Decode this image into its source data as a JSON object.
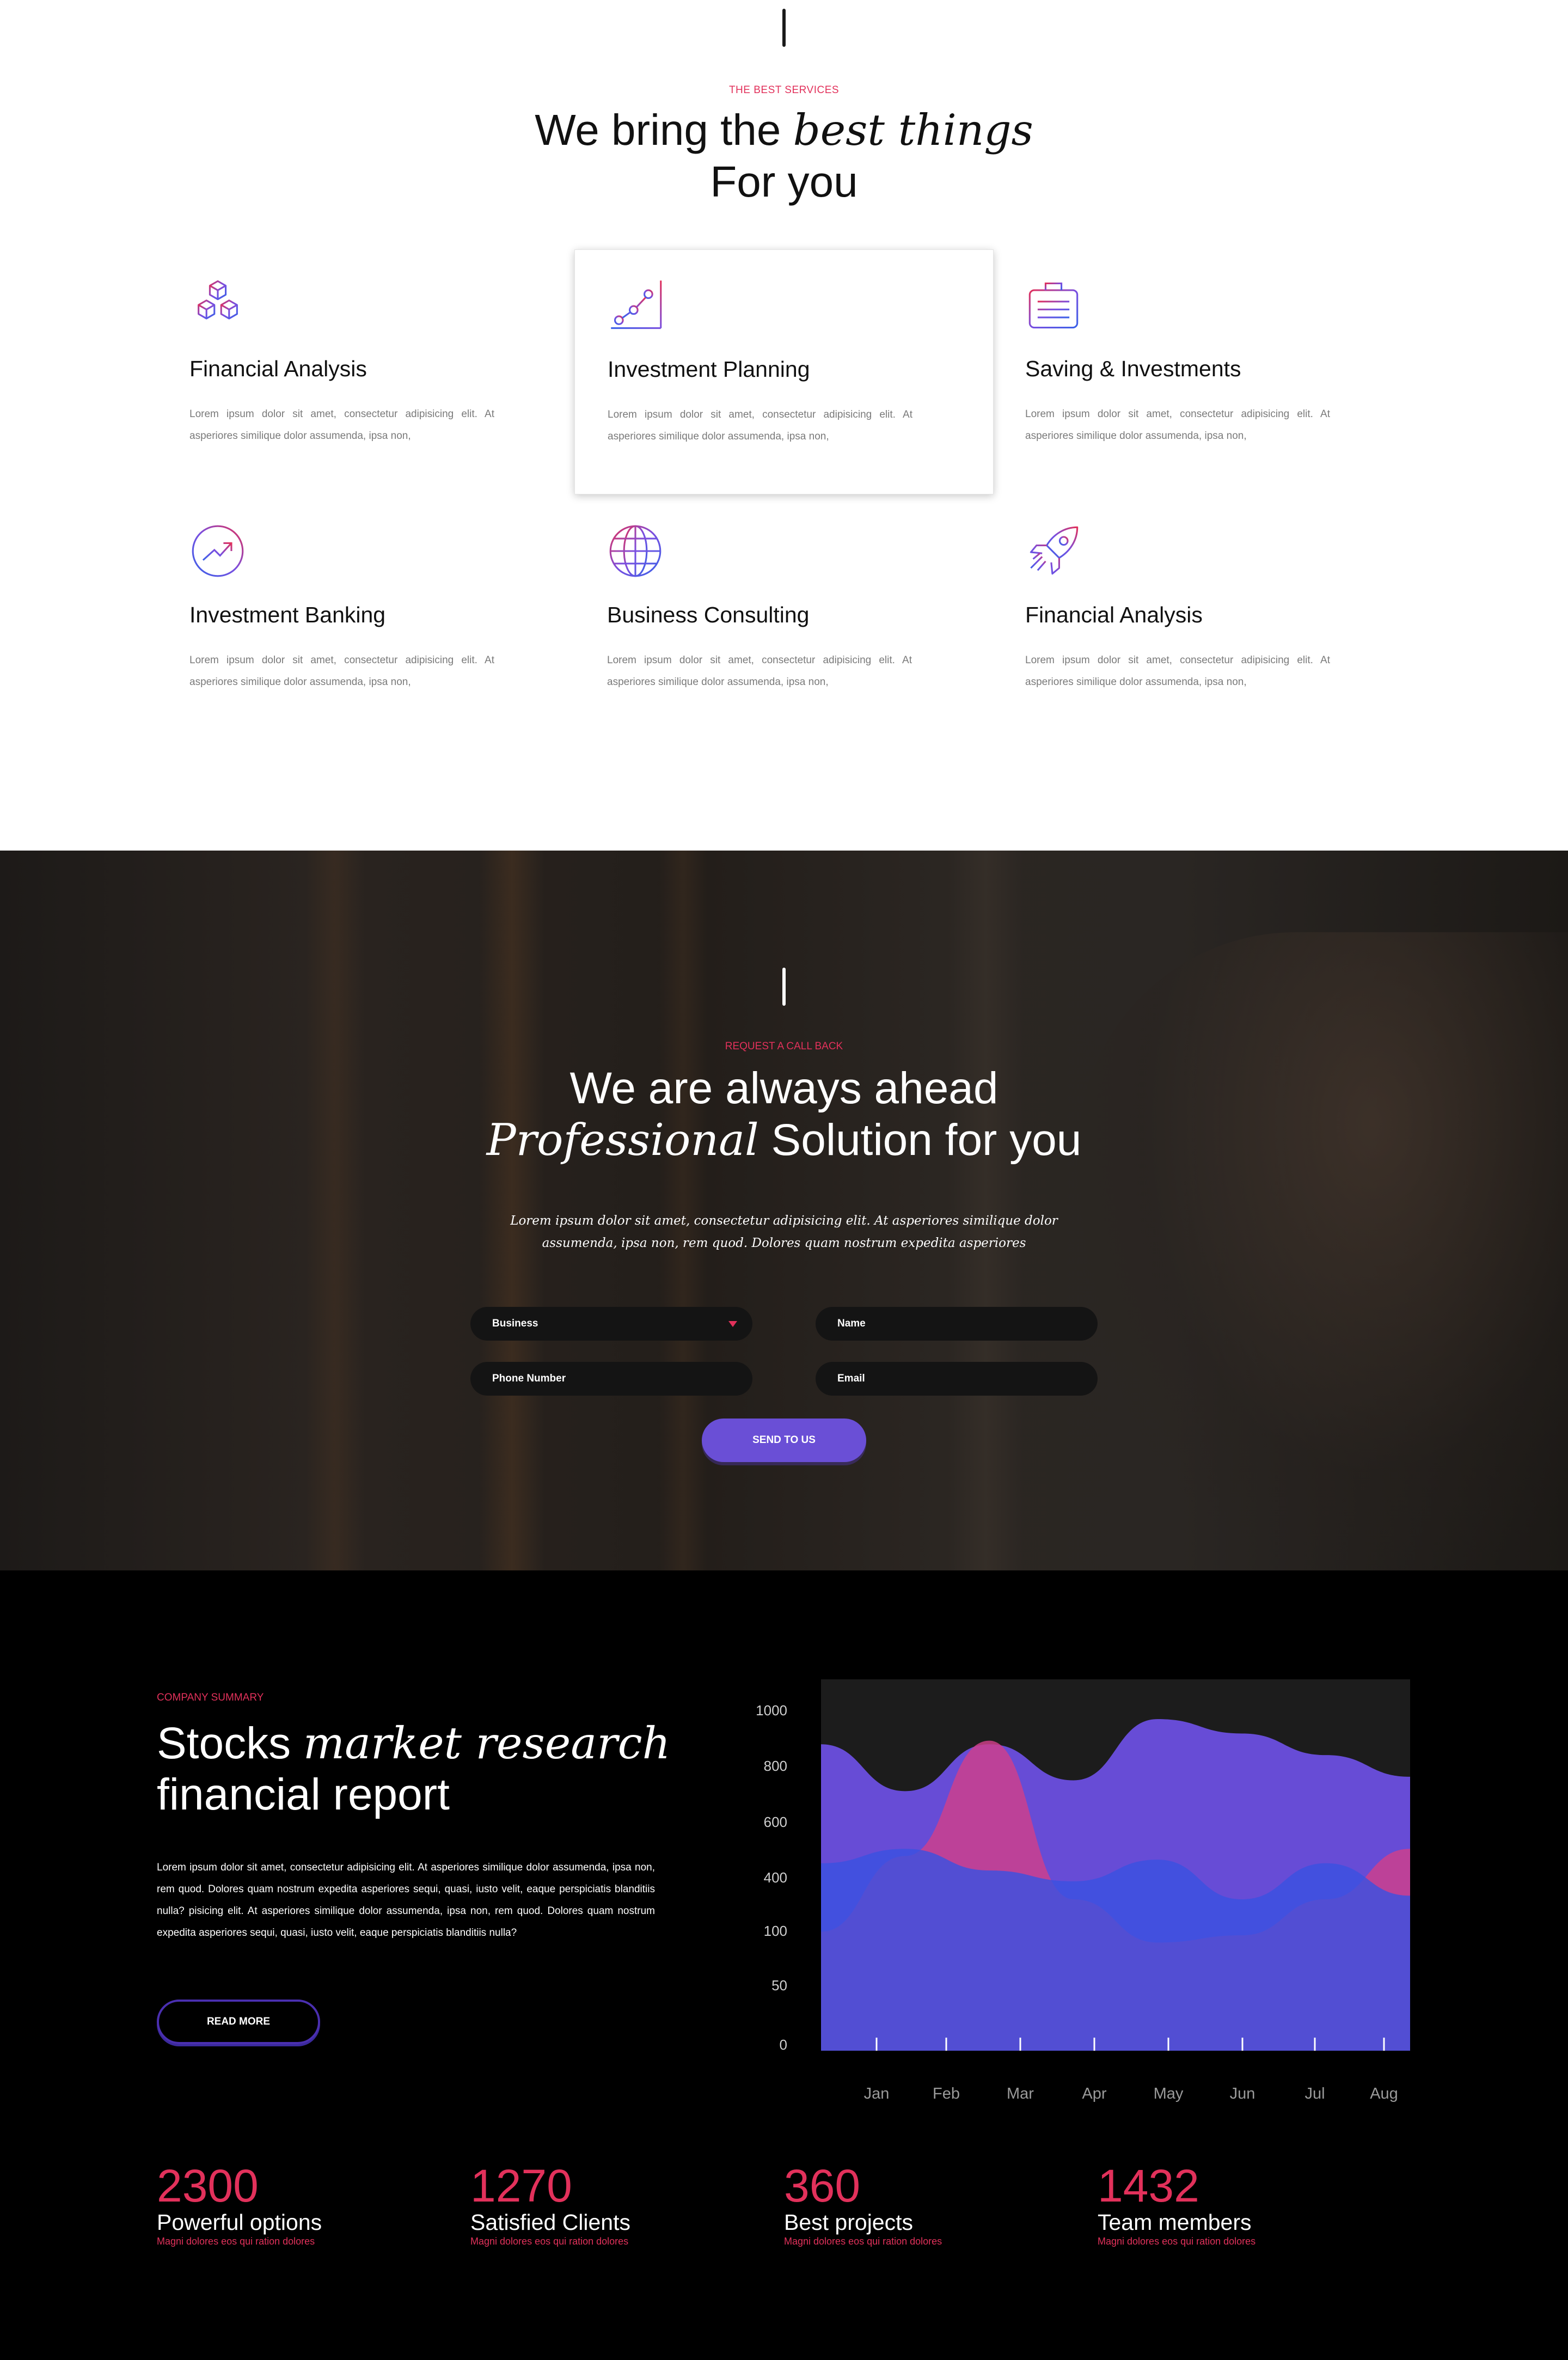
{
  "services": {
    "eyebrow": "THE BEST SERVICES",
    "title_part1": "We bring the",
    "title_italic": "best things",
    "title_part2": "For you",
    "cards": [
      {
        "title": "Financial Analysis",
        "text": "Lorem ipsum dolor sit amet, consectetur adipisicing elit. At asperiores similique dolor assumenda, ipsa non,",
        "icon": "cubes-icon"
      },
      {
        "title": "Investment Planning",
        "text": "Lorem ipsum dolor sit amet, consectetur adipisicing elit. At asperiores similique dolor assumenda, ipsa non,",
        "icon": "growth-chart-icon"
      },
      {
        "title": "Saving & Investments",
        "text": "Lorem ipsum dolor sit amet, consectetur adipisicing elit. At asperiores similique dolor assumenda, ipsa non,",
        "icon": "briefcase-icon"
      },
      {
        "title": "Investment Banking",
        "text": "Lorem ipsum dolor sit amet, consectetur adipisicing elit. At asperiores similique dolor assumenda, ipsa non,",
        "icon": "trend-circle-icon"
      },
      {
        "title": "Business Consulting",
        "text": "Lorem ipsum dolor sit amet, consectetur adipisicing elit. At asperiores similique dolor assumenda, ipsa non,",
        "icon": "globe-icon"
      },
      {
        "title": "Financial Analysis",
        "text": "Lorem ipsum dolor sit amet, consectetur adipisicing elit. At asperiores similique dolor assumenda, ipsa non,",
        "icon": "rocket-icon"
      }
    ]
  },
  "callback": {
    "eyebrow": "REQUEST A CALL BACK",
    "title_line1": "We are always ahead",
    "title_italic": "Professional",
    "title_line2_rest": "Solution for you",
    "description": "Lorem ipsum dolor sit amet, consectetur adipisicing elit. At asperiores similique dolor assumenda, ipsa non, rem quod. Dolores quam nostrum expedita asperiores",
    "form": {
      "business_select": "Business",
      "name_placeholder": "Name",
      "phone_placeholder": "Phone Number",
      "email_placeholder": "Email",
      "submit_label": "SEND TO US"
    }
  },
  "summary": {
    "eyebrow": "COMPANY SUMMARY",
    "title_part1": "Stocks",
    "title_italic": "market research",
    "title_line2": "financial report",
    "text": "Lorem ipsum dolor sit amet, consectetur adipisicing elit. At asperiores similique dolor assumenda, ipsa non, rem quod. Dolores quam nostrum expedita asperiores sequi, quasi, iusto velit, eaque perspiciatis blanditiis nulla? pisicing elit. At asperiores similique dolor assumenda, ipsa non, rem quod. Dolores quam nostrum expedita asperiores sequi, quasi, iusto velit, eaque perspiciatis blanditiis nulla?",
    "read_more_label": "READ MORE"
  },
  "chart_data": {
    "type": "area",
    "categories": [
      "Jan",
      "Feb",
      "Mar",
      "Apr",
      "May",
      "Jun",
      "Jul",
      "Aug"
    ],
    "y_ticks": [
      "1000",
      "800",
      "600",
      "400",
      "100",
      "50",
      "0"
    ],
    "series": [
      {
        "color": "#6b4fe0",
        "values": [
          850,
          720,
          850,
          750,
          920,
          880,
          820,
          760
        ]
      },
      {
        "color": "#d13f8a",
        "values": [
          330,
          540,
          860,
          420,
          300,
          320,
          420,
          560
        ]
      },
      {
        "color": "#3a52e0",
        "values": [
          520,
          560,
          500,
          470,
          530,
          420,
          520,
          430
        ]
      }
    ],
    "grid": false
  },
  "stats": [
    {
      "number": "2300",
      "label": "Powerful options",
      "sub": "Magni dolores eos qui ration dolores"
    },
    {
      "number": "1270",
      "label": "Satisfied Clients",
      "sub": "Magni dolores eos qui ration dolores"
    },
    {
      "number": "360",
      "label": "Best projects",
      "sub": "Magni dolores eos qui ration dolores"
    },
    {
      "number": "1432",
      "label": "Team members",
      "sub": "Magni dolores eos qui ration dolores"
    }
  ]
}
